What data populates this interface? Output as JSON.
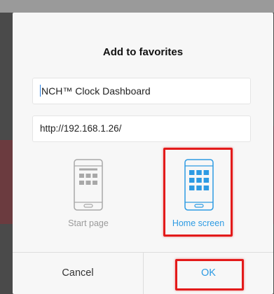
{
  "dialog": {
    "title": "Add to favorites",
    "name_field": {
      "value": "NCH™ Clock Dashboard"
    },
    "url_field": {
      "value": "http://192.168.1.26/"
    },
    "options": [
      {
        "label": "Start page",
        "icon": "phone-grid-icon",
        "selected": false
      },
      {
        "label": "Home screen",
        "icon": "phone-apps-icon",
        "selected": true
      }
    ],
    "cancel_label": "Cancel",
    "ok_label": "OK"
  },
  "colors": {
    "accent": "#2d9be3",
    "inactive": "#9a9a9a",
    "highlight": "#e31a1a"
  }
}
